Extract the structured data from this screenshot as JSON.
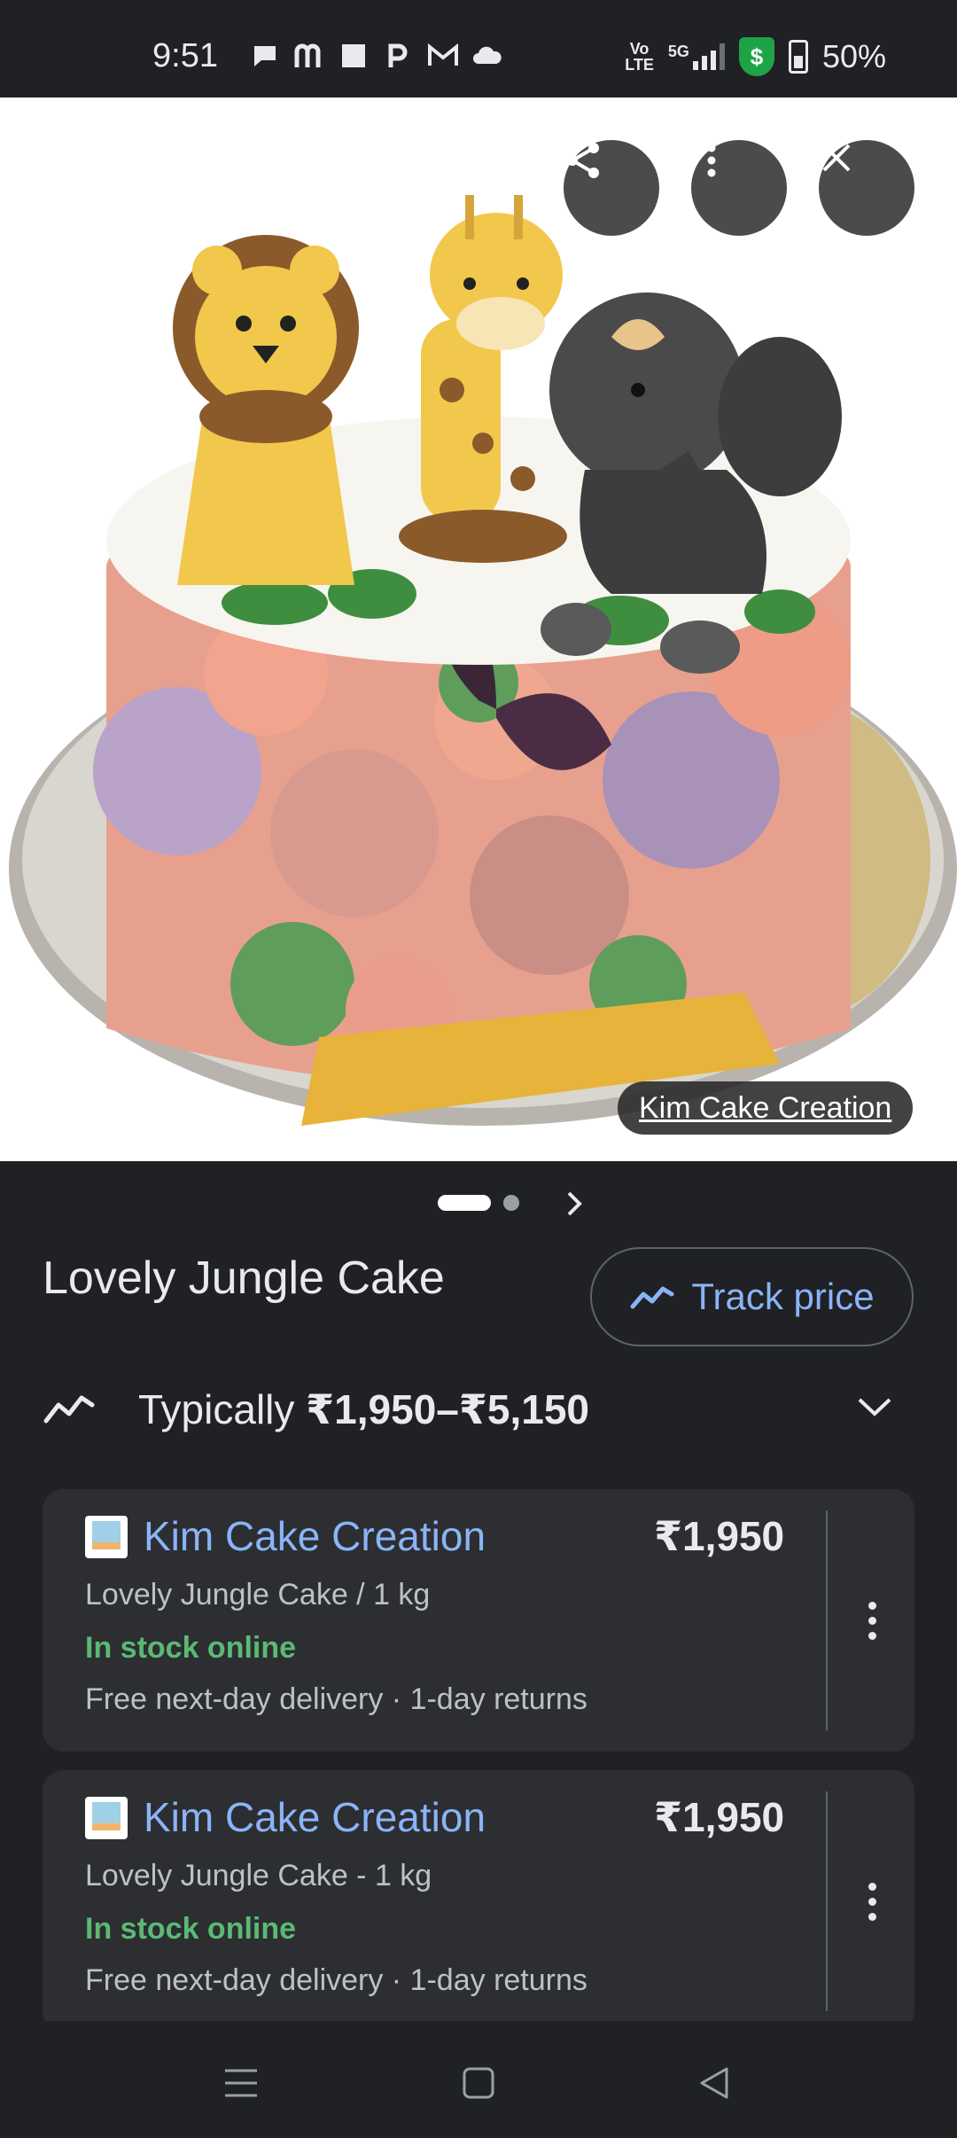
{
  "status_bar": {
    "time": "9:51",
    "network_top": "Vo",
    "network_bottom": "LTE",
    "network_5g": "5G",
    "battery": "50%",
    "shield_glyph": "$",
    "notification_icons": [
      "chat-icon",
      "m-app-icon",
      "square-icon",
      "p-app-icon",
      "gmail-icon",
      "cloud-icon"
    ]
  },
  "image_viewer": {
    "source_credit": "Kim Cake Creation",
    "buttons": [
      "share-icon",
      "more-vert-icon",
      "close-icon"
    ]
  },
  "product": {
    "title": "Lovely Jungle Cake",
    "track_price_label": "Track price",
    "typical_prefix": "Typically ",
    "typical_range": "₹1,950–₹5,150"
  },
  "offers": [
    {
      "merchant": "Kim Cake Creation",
      "price": "₹1,950",
      "product": "Lovely Jungle Cake / 1 kg",
      "stock": "In stock online",
      "delivery": "Free next-day delivery · 1-day returns"
    },
    {
      "merchant": "Kim Cake Creation",
      "price": "₹1,950",
      "product": "Lovely Jungle Cake - 1 kg",
      "stock": "In stock online",
      "delivery": "Free next-day delivery · 1-day returns"
    }
  ],
  "colors": {
    "background": "#202124",
    "card": "#2d2e31",
    "link": "#8ab4f8",
    "in_stock": "#5bb974"
  }
}
